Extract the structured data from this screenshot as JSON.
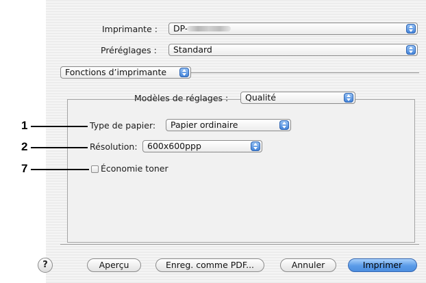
{
  "printer": {
    "label": "Imprimante :",
    "value": "DP-"
  },
  "presets": {
    "label": "Préréglages :",
    "value": "Standard"
  },
  "panel_menu": {
    "value": "Fonctions d’imprimante"
  },
  "settings_model": {
    "label": "Modèles de réglages :",
    "value": "Qualité"
  },
  "paper_type": {
    "label": "Type de papier:",
    "value": "Papier ordinaire"
  },
  "resolution": {
    "label": "Résolution:",
    "value": "600x600ppp"
  },
  "toner_save": {
    "label": "Économie toner",
    "checked": false
  },
  "callouts": [
    "1",
    "2",
    "7"
  ],
  "buttons": {
    "help": "?",
    "preview": "Aperçu",
    "save_pdf": "Enreg. comme PDF...",
    "cancel": "Annuler",
    "print": "Imprimer"
  },
  "icons": {
    "popup_arrow": "up-down-arrows-icon",
    "help": "help-icon",
    "checkbox": "checkbox-icon"
  }
}
